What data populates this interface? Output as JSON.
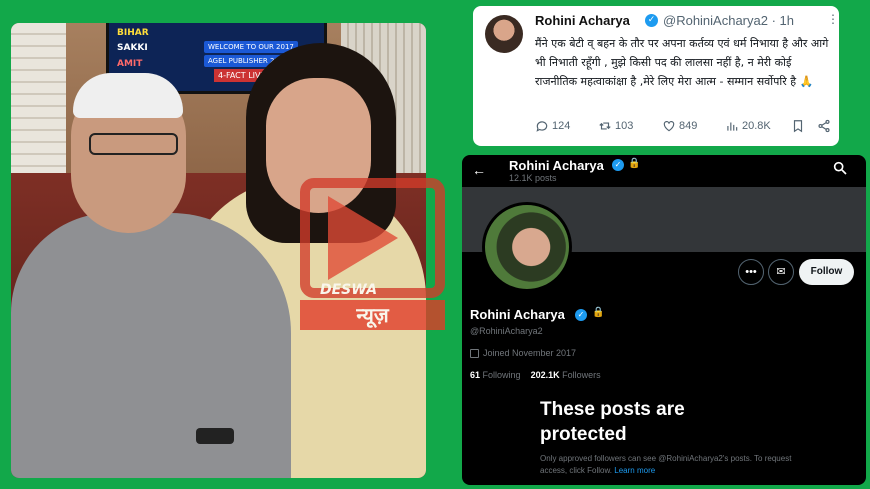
{
  "photo": {
    "tv_lines": [
      "BIHAR",
      "SAKKI",
      "AMIT",
      "WELCOME TO OUR 2017",
      "AGEL PUBLISHER 2017",
      "4-FACT LIVE"
    ]
  },
  "watermark": {
    "brand": "DESWA",
    "hindi": "न्यूज़"
  },
  "tweet": {
    "name": "Rohini Acharya",
    "handle": "@RohiniAcharya2 · 1h",
    "more": "⋮",
    "text": "मैंने एक बेटी व् बहन के तौर पर अपना कर्तव्य एवं धर्म निभाया है और आगे भी निभाती रहूँगी , मुझे किसी पद की लालसा नहीं है, न मेरी कोई राजनीतिक महत्वाकांक्षा है ,मेरे लिए मेरा आत्म - सम्मान सर्वोपरि है 🙏",
    "replies": "124",
    "retweets": "103",
    "likes": "849",
    "views": "20.8K"
  },
  "profile": {
    "top_name": "Rohini Acharya",
    "posts": "12.1K posts",
    "follow_label": "Follow",
    "name": "Rohini Acharya",
    "handle": "@RohiniAcharya2",
    "joined": "Joined November 2017",
    "following_count": "61",
    "following_label": "Following",
    "followers_count": "202.1K",
    "followers_label": "Followers",
    "protected_title": "These posts are protected",
    "note_text": "Only approved followers can see @RohiniAcharya2's posts. To request access, click Follow.",
    "learn_more": "Learn more"
  },
  "colors": {
    "background": "#12a84a",
    "verified": "#1d9bf0",
    "watermark": "#e23a28"
  }
}
